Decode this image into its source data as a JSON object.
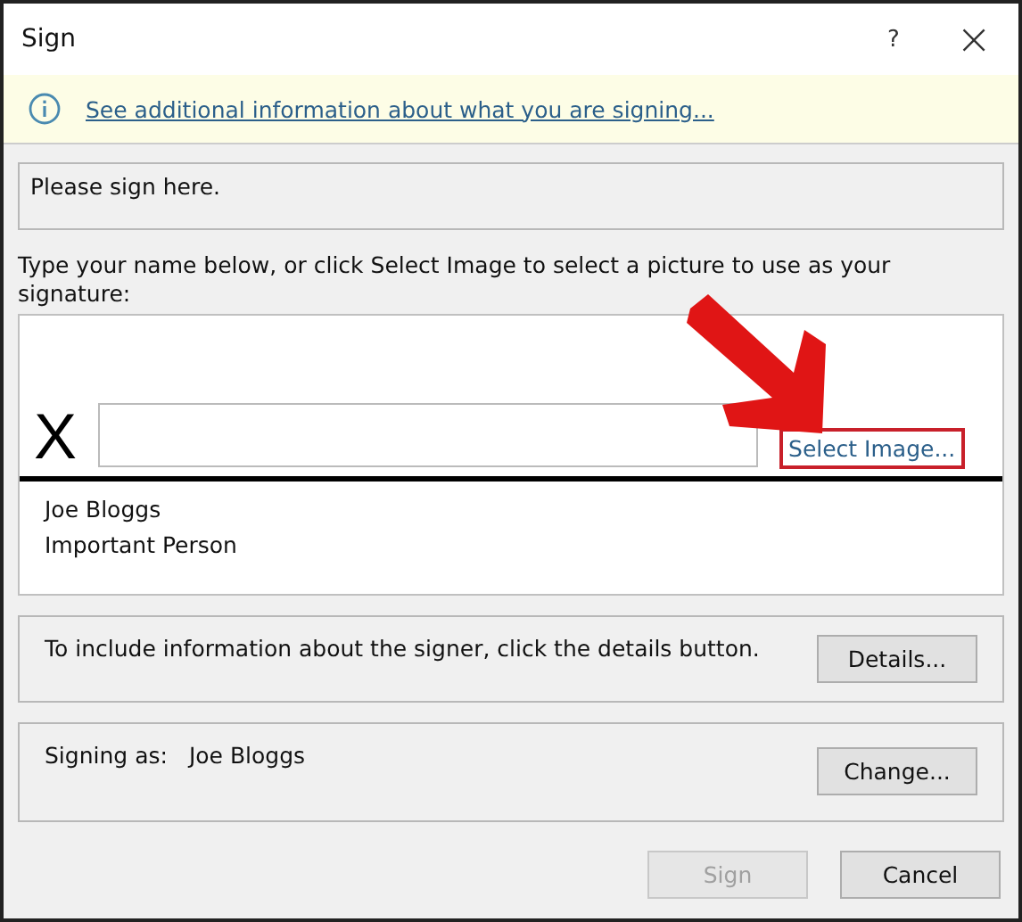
{
  "window": {
    "title": "Sign",
    "help": "?",
    "close": "×"
  },
  "info_bar": {
    "link": "See additional information about what you are signing..."
  },
  "purpose": {
    "text": "Please sign here."
  },
  "instructions": "Type your name below, or click Select Image to select a picture to use as your signature:",
  "signature": {
    "mark": "X",
    "select_image": {
      "label": "Select Image...",
      "highlighted": true
    },
    "signer_lines": [
      "Joe Bloggs",
      "Important Person"
    ]
  },
  "details": {
    "text": "To include information about the signer, click the details button.",
    "button": "Details..."
  },
  "signing_as": {
    "label": "Signing as:",
    "name": "Joe Bloggs",
    "button": "Change..."
  },
  "buttons": [
    {
      "label": "Sign",
      "disabled": true
    },
    {
      "label": "Cancel",
      "disabled": false
    }
  ]
}
